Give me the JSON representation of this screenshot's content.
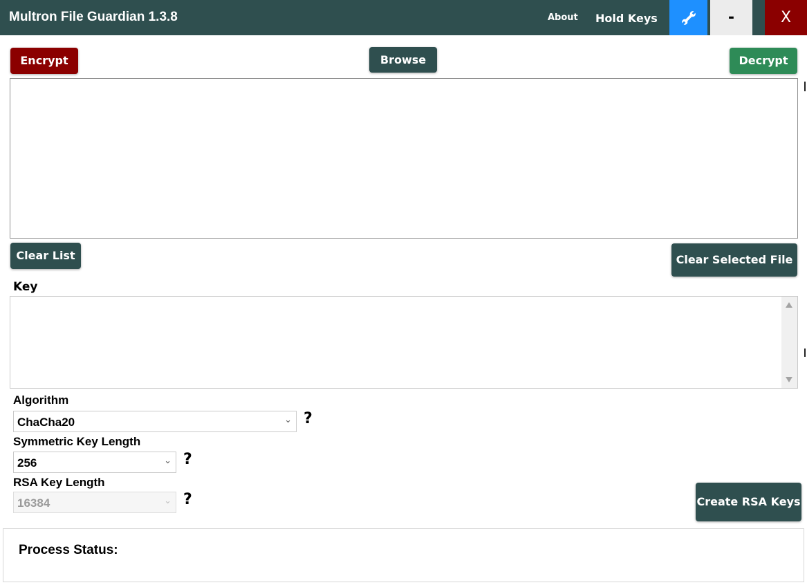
{
  "window": {
    "title": "Multron File Guardian 1.3.8",
    "menu": {
      "about_label": "About",
      "hold_keys_label": "Hold Keys"
    },
    "controls": {
      "tools_icon": "wrench-icon",
      "minimize_label": "-",
      "close_label": "X"
    }
  },
  "toolbar": {
    "encrypt_label": "Encrypt",
    "browse_label": "Browse",
    "decrypt_label": "Decrypt"
  },
  "file_list": {
    "items": []
  },
  "list_actions": {
    "clear_list_label": "Clear List",
    "clear_selected_label": "Clear Selected File"
  },
  "key": {
    "label": "Key",
    "value": ""
  },
  "algorithm": {
    "label": "Algorithm",
    "selected": "ChaCha20",
    "help": "?"
  },
  "symmetric_key_length": {
    "label": "Symmetric Key Length",
    "selected": "256",
    "help": "?"
  },
  "rsa_key_length": {
    "label": "RSA Key Length",
    "selected": "16384",
    "disabled": true,
    "help": "?"
  },
  "create_rsa": {
    "label": "Create RSA Keys"
  },
  "status": {
    "label": "Process Status:",
    "value": ""
  },
  "colors": {
    "titlebar": "#2f4f4f",
    "button_dark": "#2f4f4f",
    "encrypt": "#8b0000",
    "decrypt": "#2e8b57",
    "tools_accent": "#1e90ff",
    "close": "#8b0000"
  }
}
